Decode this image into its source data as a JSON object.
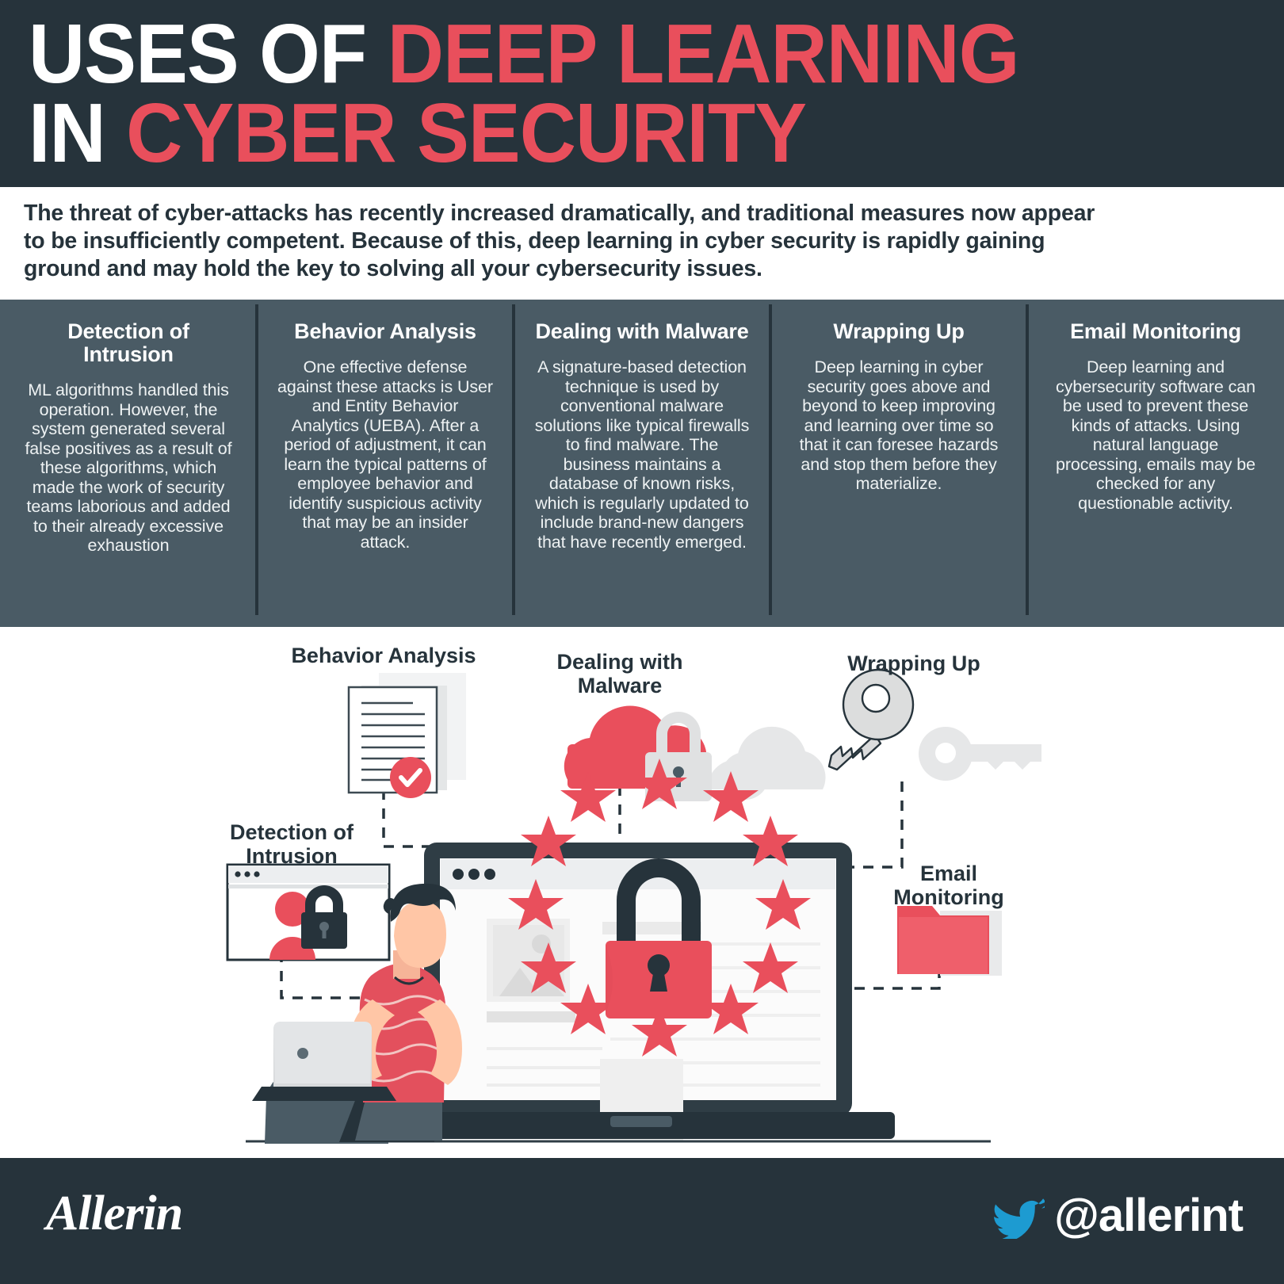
{
  "header": {
    "title_line1_white": "USES OF ",
    "title_line1_red": "DEEP LEARNING",
    "title_line2_white": "IN ",
    "title_line2_red": "CYBER SECURITY",
    "background_color": "#26333b",
    "accent_color": "#e94f5c"
  },
  "intro": {
    "paragraph": "The threat of cyber-attacks has recently increased dramatically, and traditional measures now appear to be insufficiently competent. Because of this, deep learning in cyber security is rapidly gaining ground and may hold the key to solving all your cybersecurity issues."
  },
  "band": {
    "background_color": "#4a5b65",
    "divider_color": "#26333b",
    "columns": [
      {
        "title": "Detection of Intrusion",
        "body": "ML algorithms handled this operation. However, the system generated several false positives as a result of these algorithms, which made the work of security teams laborious and added to their already excessive exhaustion"
      },
      {
        "title": "Behavior Analysis",
        "body": "One effective defense against these attacks is User and Entity Behavior Analytics (UEBA). After a period of adjustment, it can learn the typical patterns of employee behavior and identify suspicious activity that may be an insider attack."
      },
      {
        "title": "Dealing with Malware",
        "body": "A signature-based detection technique is used by conventional malware solutions like typical firewalls to find malware. The business maintains a database of known risks, which is regularly updated to include brand-new dangers that have recently emerged."
      },
      {
        "title": "Wrapping Up",
        "body": "Deep learning in cyber security goes above and beyond to keep improving and learning over time so that it can foresee hazards and stop them before they materialize."
      },
      {
        "title": "Email Monitoring",
        "body": "Deep learning and cybersecurity software can be used to prevent these kinds of attacks. Using natural language processing, emails may be checked for any questionable activity."
      }
    ]
  },
  "illustration": {
    "labels": [
      {
        "id": "behavior-analysis",
        "text": "Behavior Analysis",
        "icon": "document-check-icon"
      },
      {
        "id": "dealing-with-malware",
        "text": "Dealing with Malware",
        "icon": "cloud-lock-icon"
      },
      {
        "id": "wrapping-up",
        "text": "Wrapping Up",
        "icon": "key-icon"
      },
      {
        "id": "detection-of-intrusion",
        "text": "Detection of Intrusion",
        "icon": "browser-user-lock-icon"
      },
      {
        "id": "email-monitoring",
        "text": "Email Monitoring",
        "icon": "folder-icon"
      }
    ],
    "center_icon": "padlock-stars-icon",
    "person_icon": "person-with-laptop-icon"
  },
  "footer": {
    "background_color": "#26333b",
    "brand": "Allerin",
    "brand_flame_color": "#f15a22",
    "twitter_handle": "@allerint",
    "twitter_icon_color": "#1d9bd1"
  }
}
